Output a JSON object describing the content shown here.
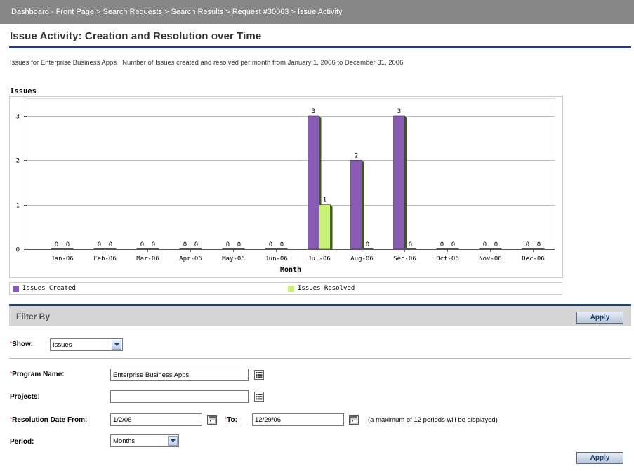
{
  "breadcrumb": {
    "items": [
      "Dashboard - Front Page",
      "Search Requests",
      "Search Results",
      "Request #30063"
    ],
    "current": "Issue Activity",
    "separator": ">"
  },
  "page": {
    "title": "Issue Activity: Creation and Resolution over Time",
    "subtitle_program": "Issues for Enterprise Business Apps",
    "subtitle_desc": "Number of Issues created and resolved per month from January 1, 2006 to December 31, 2006"
  },
  "chart_data": {
    "type": "bar",
    "title": "Issues",
    "xlabel": "Month",
    "ylabel": "",
    "ylim": [
      0,
      3
    ],
    "yticks": [
      "0",
      "1",
      "2",
      "3"
    ],
    "categories": [
      "Jan-06",
      "Feb-06",
      "Mar-06",
      "Apr-06",
      "May-06",
      "Jun-06",
      "Jul-06",
      "Aug-06",
      "Sep-06",
      "Oct-06",
      "Nov-06",
      "Dec-06"
    ],
    "series": [
      {
        "name": "Issues Created",
        "values": [
          0,
          0,
          0,
          0,
          0,
          0,
          3,
          2,
          3,
          0,
          0,
          0
        ],
        "color": "#8a5bb5"
      },
      {
        "name": "Issues Resolved",
        "values": [
          0,
          0,
          0,
          0,
          0,
          0,
          1,
          0,
          0,
          0,
          0,
          0
        ],
        "color": "#c9f277"
      }
    ],
    "grid": true,
    "legend": "bottom"
  },
  "filter": {
    "title": "Filter By",
    "apply_label": "Apply",
    "show_label": "Show:",
    "show_value": "Issues",
    "program_label": "Program Name:",
    "program_value": "Enterprise Business Apps",
    "projects_label": "Projects:",
    "projects_value": "",
    "res_from_label": "Resolution Date From:",
    "res_from_value": "1/2/06",
    "to_label": "To:",
    "to_value": "12/29/06",
    "max_note": "(a maximum of 12 periods will be displayed)",
    "period_label": "Period:",
    "period_value": "Months"
  },
  "colors": {
    "accent": "#1f3e6b",
    "breadcrumb_bg": "#878787",
    "filter_bar_bg": "#d6d6d6",
    "required": "#cc0000"
  },
  "icons": {
    "list_icon": "list-picker-icon",
    "calendar_icon": "calendar-icon",
    "dropdown_icon": "chevron-down-icon"
  }
}
